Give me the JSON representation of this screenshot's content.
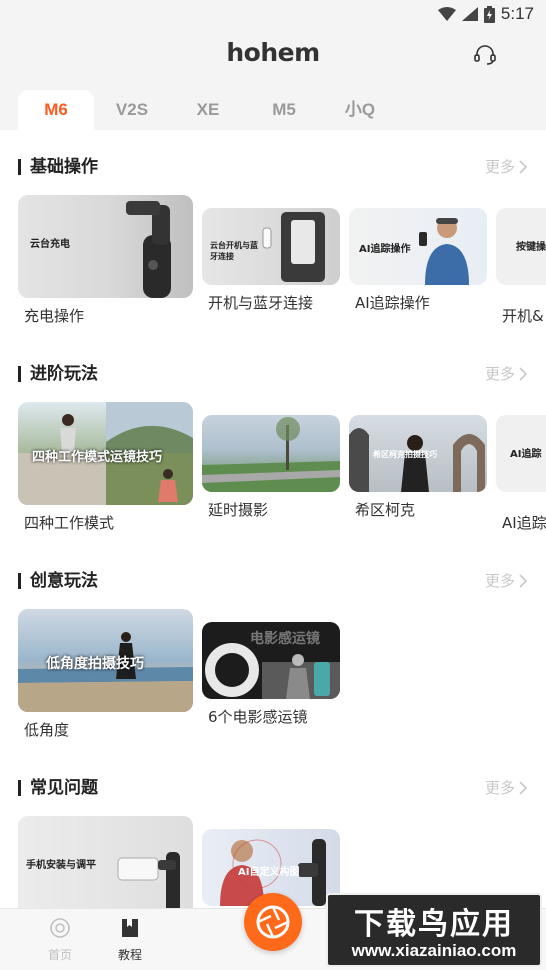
{
  "status_bar": {
    "time": "5:17"
  },
  "header": {
    "logo": "hohem"
  },
  "tabs": [
    {
      "label": "M6",
      "active": true
    },
    {
      "label": "V2S",
      "active": false
    },
    {
      "label": "XE",
      "active": false
    },
    {
      "label": "M5",
      "active": false
    },
    {
      "label": "小Q",
      "active": false
    }
  ],
  "sections": [
    {
      "title": "基础操作",
      "more": "更多",
      "cards": [
        {
          "label": "充电操作",
          "thumb_text": "云台充电"
        },
        {
          "label": "开机与蓝牙连接",
          "thumb_text": "云台开机与蓝牙连接"
        },
        {
          "label": "AI追踪操作",
          "thumb_text": "AI追踪操作"
        },
        {
          "label": "开机&",
          "thumb_text": "按键操"
        }
      ]
    },
    {
      "title": "进阶玩法",
      "more": "更多",
      "cards": [
        {
          "label": "四种工作模式",
          "thumb_text": "四种工作模式运镜技巧"
        },
        {
          "label": "延时摄影",
          "thumb_text": ""
        },
        {
          "label": "希区柯克",
          "thumb_text": "希区柯克拍摄技巧"
        },
        {
          "label": "AI追踪",
          "thumb_text": "AI追踪"
        }
      ]
    },
    {
      "title": "创意玩法",
      "more": "更多",
      "cards": [
        {
          "label": "低角度",
          "thumb_text": "低角度拍摄技巧"
        },
        {
          "label": "6个电影感运镜",
          "thumb_text": "电影感运镜"
        }
      ]
    },
    {
      "title": "常见问题",
      "more": "更多",
      "cards": [
        {
          "label": "",
          "thumb_text": "手机安装与调平"
        },
        {
          "label": "",
          "thumb_text": "AI自定义构图"
        }
      ]
    }
  ],
  "bottom_nav": [
    {
      "label": "首页",
      "active": false
    },
    {
      "label": "教程",
      "active": true
    }
  ],
  "watermark": {
    "top": "下载鸟应用",
    "bottom": "www.xiazainiao.com"
  },
  "colors": {
    "accent": "#ff5a1f",
    "tab_inactive": "#9a9a9a",
    "more": "#c8c8c8",
    "background": "#f4f4f4"
  }
}
